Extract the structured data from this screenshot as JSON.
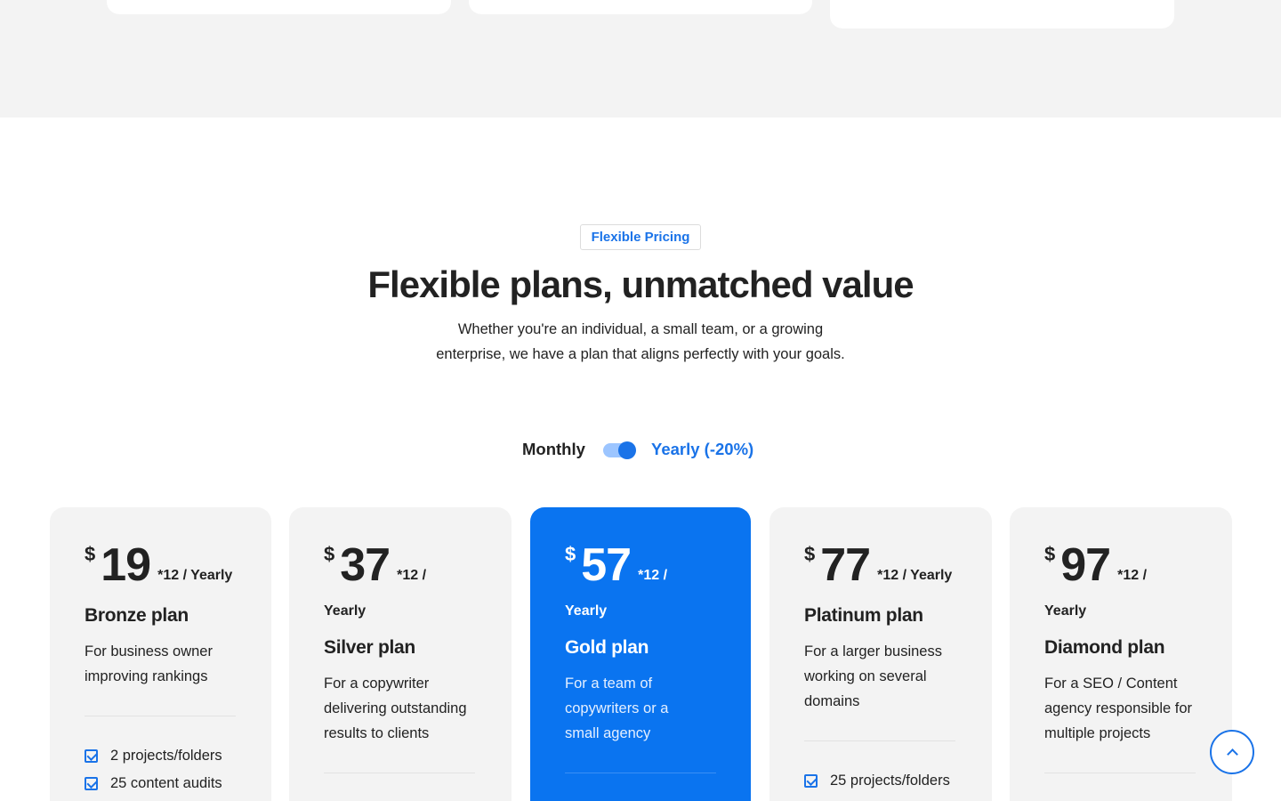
{
  "section": {
    "badge": "Flexible Pricing",
    "heading": "Flexible plans, unmatched value",
    "subtext": "Whether you're an individual, a small team, or a growing enterprise, we have a plan that aligns perfectly with your goals."
  },
  "toggle": {
    "monthly_label": "Monthly",
    "yearly_label": "Yearly (-20%)",
    "selected": "yearly"
  },
  "colors": {
    "accent": "#1a73e8",
    "gold_card": "#0a74f0",
    "card_bg": "#f3f3f3"
  },
  "plans": [
    {
      "currency": "$",
      "amount": "19",
      "period": "*12 / Yearly",
      "name": "Bronze plan",
      "description": "For business owner improving rankings",
      "features": [
        "2 projects/folders",
        "25 content audits"
      ]
    },
    {
      "currency": "$",
      "amount": "37",
      "period_a": "*12 /",
      "period_b": "Yearly",
      "name": "Silver plan",
      "description": "For a copywriter delivering outstanding results to clients"
    },
    {
      "currency": "$",
      "amount": "57",
      "period_a": "*12 /",
      "period_b": "Yearly",
      "name": "Gold plan",
      "description": "For a team of copywriters or a small agency"
    },
    {
      "currency": "$",
      "amount": "77",
      "period": "*12 / Yearly",
      "name": "Platinum plan",
      "description": "For a larger business working on several domains",
      "features": [
        "25 projects/folders"
      ]
    },
    {
      "currency": "$",
      "amount": "97",
      "period_a": "*12 /",
      "period_b": "Yearly",
      "name": "Diamond plan",
      "description": "For a SEO / Content agency responsible for multiple projects"
    }
  ]
}
